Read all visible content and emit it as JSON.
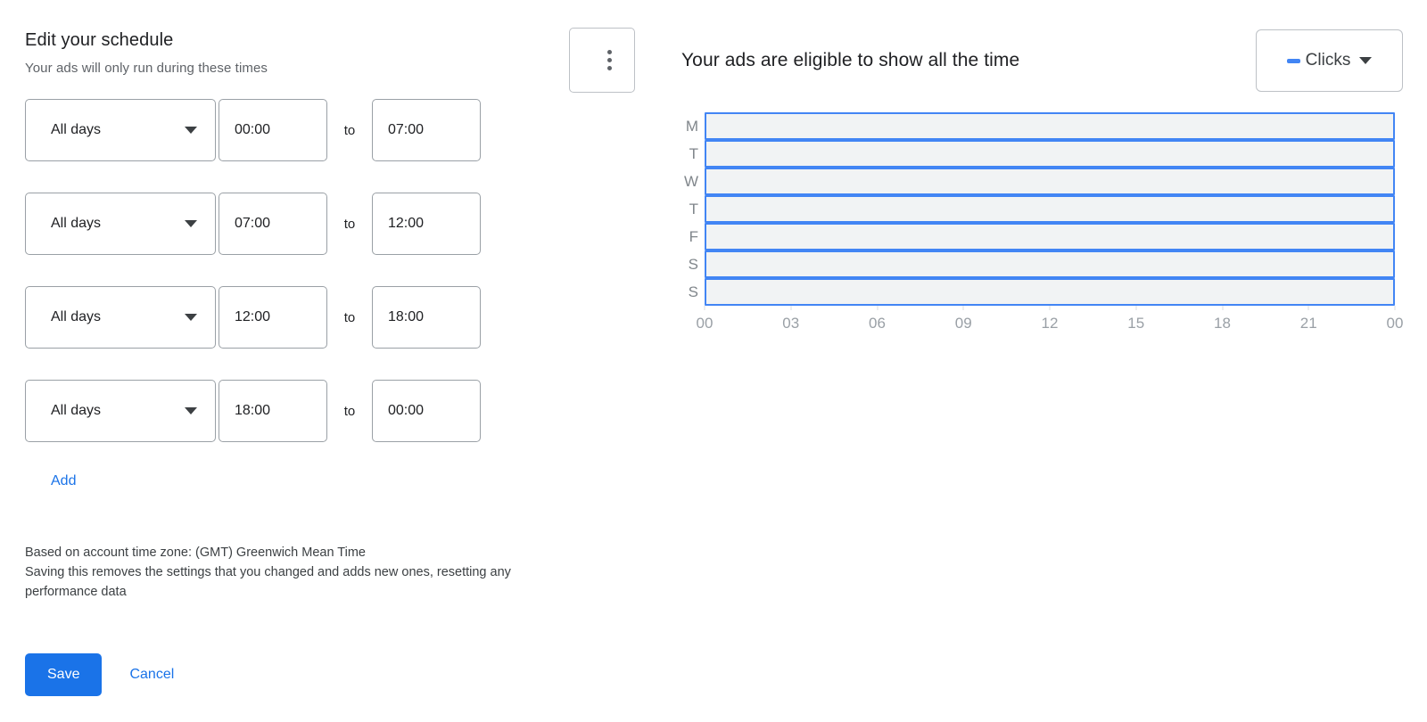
{
  "left": {
    "title": "Edit your schedule",
    "subtitle": "Your ads will only run during these times",
    "to_label": "to",
    "add_label": "Add",
    "note_line1": "Based on account time zone: (GMT) Greenwich Mean Time",
    "note_line2": "Saving this removes the settings that you changed and adds new ones, resetting any performance data",
    "save_label": "Save",
    "cancel_label": "Cancel",
    "rows": [
      {
        "days": "All days",
        "start": "00:00",
        "end": "07:00"
      },
      {
        "days": "All days",
        "start": "07:00",
        "end": "12:00"
      },
      {
        "days": "All days",
        "start": "12:00",
        "end": "18:00"
      },
      {
        "days": "All days",
        "start": "18:00",
        "end": "00:00"
      }
    ]
  },
  "right": {
    "kebab_icon": "more-vert-icon",
    "chart_heading": "Your ads are eligible to show all the time",
    "metric_selected": "Clicks",
    "metric_marker_color": "#4285f4"
  },
  "colors": {
    "accent_blue": "#1a73e8",
    "chart_blue": "#4285f4",
    "bar_fill": "#f1f3f4",
    "border_gray": "#9aa0a6",
    "text_primary": "#202124",
    "text_secondary": "#5f6368",
    "tick_gray": "#9aa0a6"
  },
  "chart_data": {
    "type": "bar",
    "title": "Your ads are eligible to show all the time",
    "xlabel": "",
    "ylabel": "",
    "orientation": "horizontal",
    "grid": false,
    "legend_position": "top-right",
    "legend": [
      "Clicks"
    ],
    "categories": [
      "M",
      "T",
      "W",
      "T",
      "F",
      "S",
      "S"
    ],
    "category_names": [
      "Monday",
      "Tuesday",
      "Wednesday",
      "Thursday",
      "Friday",
      "Saturday",
      "Sunday"
    ],
    "xticks": [
      "00",
      "03",
      "06",
      "09",
      "12",
      "15",
      "18",
      "21",
      "00"
    ],
    "xlim": [
      0,
      24
    ],
    "series": [
      {
        "name": "Clicks",
        "note": "Each day is fully covered 00:00-24:00 (ads eligible all the time)",
        "values": [
          24,
          24,
          24,
          24,
          24,
          24,
          24
        ]
      }
    ]
  }
}
